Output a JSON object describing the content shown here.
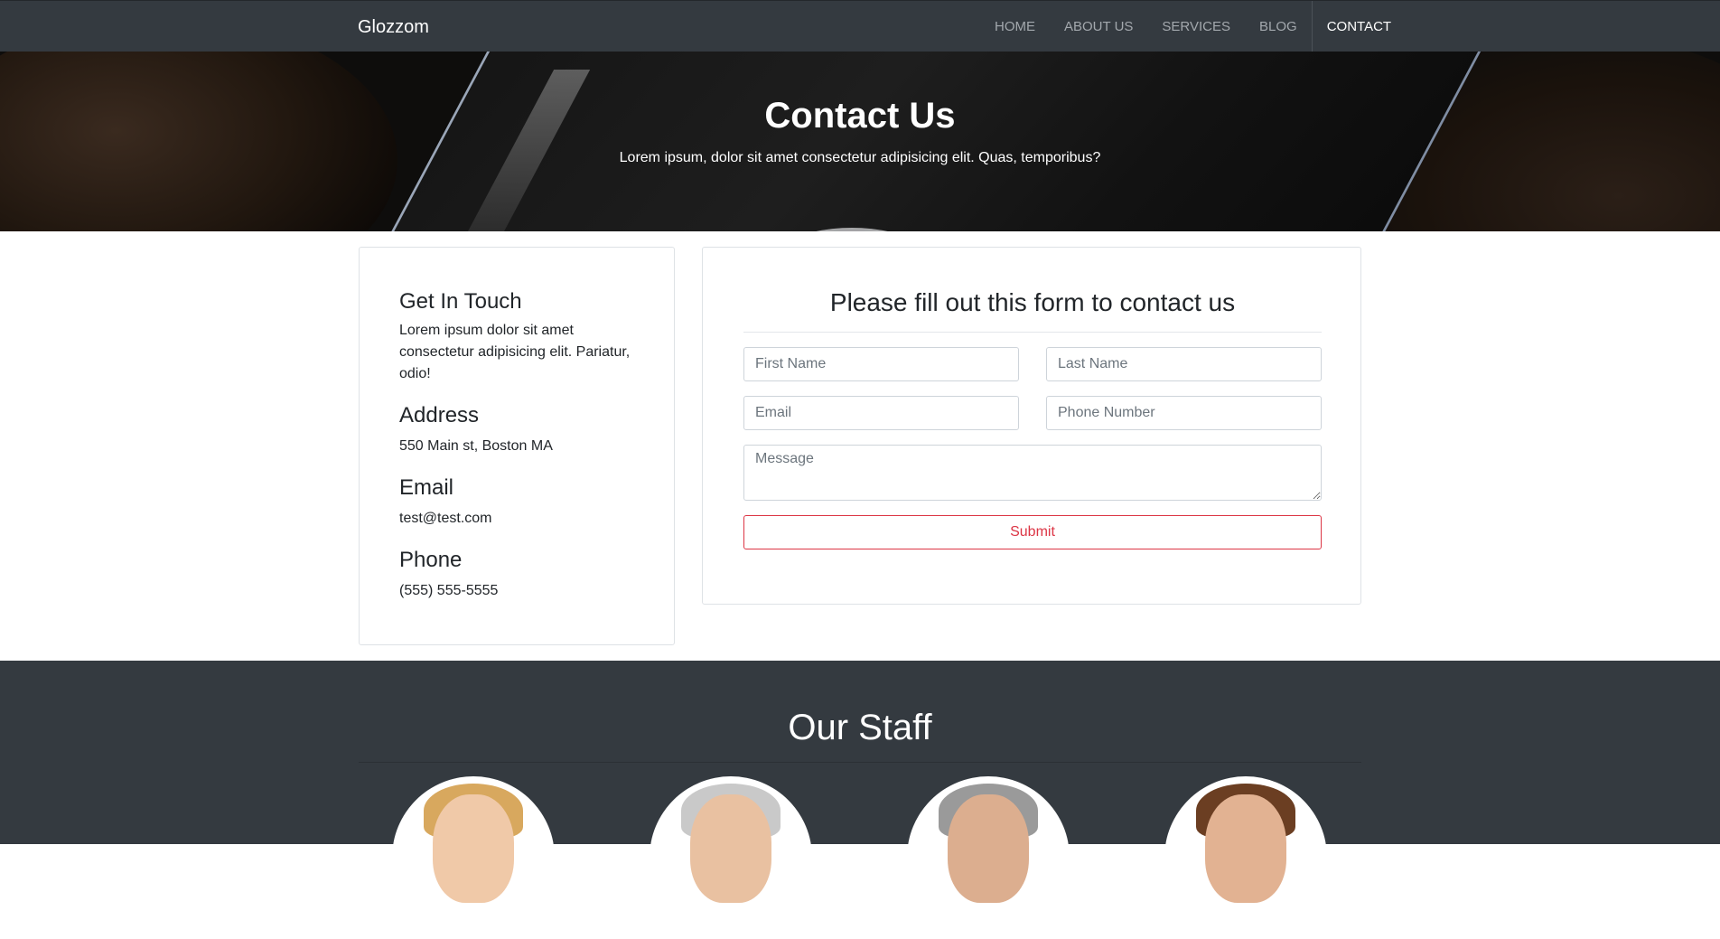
{
  "nav": {
    "brand": "Glozzom",
    "links": [
      {
        "label": "HOME"
      },
      {
        "label": "ABOUT US"
      },
      {
        "label": "SERVICES"
      },
      {
        "label": "BLOG"
      },
      {
        "label": "CONTACT"
      }
    ],
    "active_index": 4
  },
  "hero": {
    "title": "Contact Us",
    "subtitle": "Lorem ipsum, dolor sit amet consectetur adipisicing elit. Quas, temporibus?"
  },
  "info": {
    "heading": "Get In Touch",
    "text": "Lorem ipsum dolor sit amet consectetur adipisicing elit. Pariatur, odio!",
    "address_label": "Address",
    "address_value": "550 Main st, Boston MA",
    "email_label": "Email",
    "email_value": "test@test.com",
    "phone_label": "Phone",
    "phone_value": "(555) 555-5555"
  },
  "form": {
    "title": "Please fill out this form to contact us",
    "first_name_placeholder": "First Name",
    "last_name_placeholder": "Last Name",
    "email_placeholder": "Email",
    "phone_placeholder": "Phone Number",
    "message_placeholder": "Message",
    "submit_label": "Submit"
  },
  "staff": {
    "title": "Our Staff"
  },
  "colors": {
    "navbar": "#343a40",
    "accent_danger": "#dc3545",
    "text": "#212529"
  }
}
